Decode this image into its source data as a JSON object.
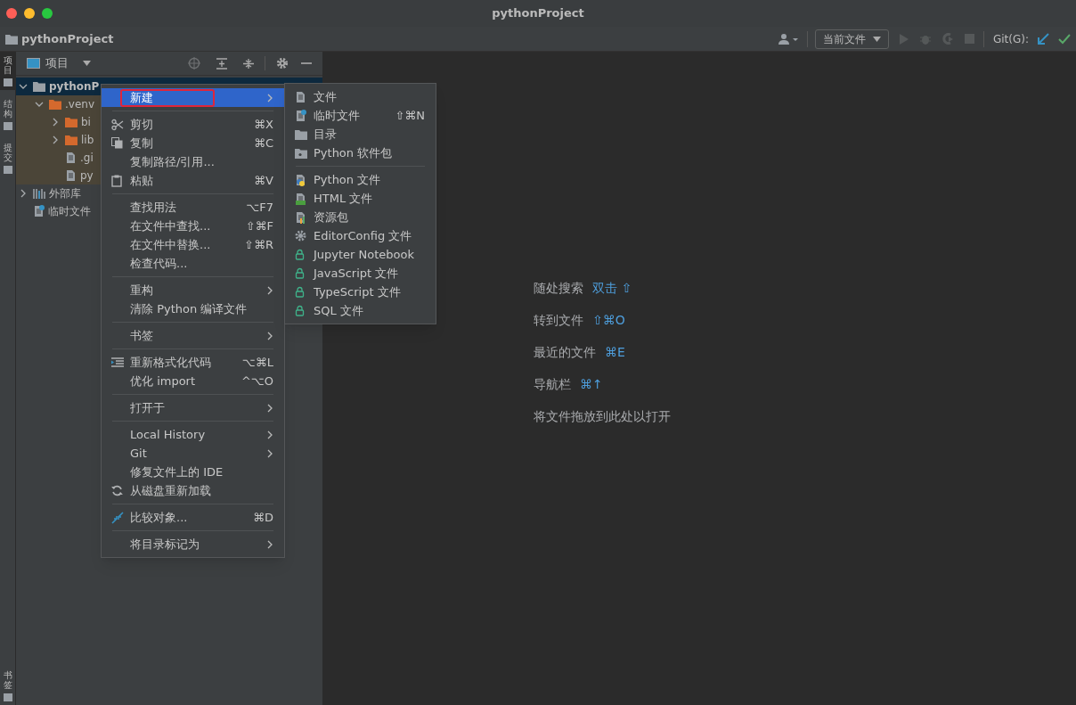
{
  "window": {
    "title": "pythonProject"
  },
  "nav_bar": {
    "project": "pythonProject",
    "run_config": "当前文件",
    "git_label": "Git(G):"
  },
  "left_stripe": [
    {
      "label": "项目",
      "selected": true
    },
    {
      "label": "结构",
      "selected": false
    },
    {
      "label": "提交",
      "selected": false
    }
  ],
  "left_stripe_bottom": [
    {
      "label": "书签",
      "selected": false
    }
  ],
  "project_panel": {
    "title": "项目",
    "tree": [
      {
        "label": "pythonP",
        "kind": "folder",
        "expanded": true,
        "selected": true,
        "children": [
          {
            "label": ".venv",
            "kind": "excluded",
            "expanded": true,
            "selected": false,
            "children": [
              {
                "label": "bi",
                "kind": "excluded",
                "expanded": false,
                "selected": false
              },
              {
                "label": "lib",
                "kind": "excluded",
                "expanded": false,
                "selected": false
              },
              {
                "label": ".gi",
                "kind": "ignored",
                "selected": false
              },
              {
                "label": "py",
                "kind": "file",
                "selected": false
              }
            ]
          }
        ]
      },
      {
        "label": "外部库",
        "kind": "library",
        "expanded": false,
        "selected": false
      },
      {
        "label": "临时文件",
        "kind": "scratch",
        "selected": false
      }
    ]
  },
  "context_menu": [
    {
      "kind": "item",
      "label": "新建",
      "submenu": true,
      "selected": true,
      "annotated": true
    },
    {
      "kind": "separator"
    },
    {
      "kind": "item",
      "label": "剪切",
      "shortcut": "⌘X",
      "selected": false
    },
    {
      "kind": "item",
      "label": "复制",
      "shortcut": "⌘C",
      "selected": false
    },
    {
      "kind": "item",
      "label": "复制路径/引用...",
      "selected": false
    },
    {
      "kind": "item",
      "label": "粘贴",
      "shortcut": "⌘V",
      "selected": false
    },
    {
      "kind": "separator"
    },
    {
      "kind": "item",
      "label": "查找用法",
      "shortcut": "⌥F7",
      "selected": false
    },
    {
      "kind": "item",
      "label": "在文件中查找...",
      "shortcut": "⇧⌘F",
      "selected": false
    },
    {
      "kind": "item",
      "label": "在文件中替换...",
      "shortcut": "⇧⌘R",
      "selected": false
    },
    {
      "kind": "item",
      "label": "检查代码...",
      "selected": false
    },
    {
      "kind": "separator"
    },
    {
      "kind": "item",
      "label": "重构",
      "submenu": true,
      "selected": false
    },
    {
      "kind": "item",
      "label": "清除 Python 编译文件",
      "selected": false
    },
    {
      "kind": "separator"
    },
    {
      "kind": "item",
      "label": "书签",
      "submenu": true,
      "selected": false
    },
    {
      "kind": "separator"
    },
    {
      "kind": "item",
      "label": "重新格式化代码",
      "shortcut": "⌥⌘L",
      "selected": false
    },
    {
      "kind": "item",
      "label": "优化 import",
      "shortcut": "^⌥O",
      "selected": false
    },
    {
      "kind": "separator"
    },
    {
      "kind": "item",
      "label": "打开于",
      "submenu": true,
      "selected": false
    },
    {
      "kind": "separator"
    },
    {
      "kind": "item",
      "label": "Local History",
      "submenu": true,
      "selected": false
    },
    {
      "kind": "item",
      "label": "Git",
      "submenu": true,
      "selected": false
    },
    {
      "kind": "item",
      "label": "修复文件上的 IDE",
      "selected": false
    },
    {
      "kind": "item",
      "label": "从磁盘重新加载",
      "selected": false
    },
    {
      "kind": "separator"
    },
    {
      "kind": "item",
      "label": "比较对象...",
      "shortcut": "⌘D",
      "selected": false
    },
    {
      "kind": "separator"
    },
    {
      "kind": "item",
      "label": "将目录标记为",
      "submenu": true,
      "selected": false
    }
  ],
  "new_submenu": [
    {
      "kind": "item",
      "label": "文件",
      "selected": false
    },
    {
      "kind": "item",
      "label": "临时文件",
      "shortcut": "⇧⌘N",
      "selected": false
    },
    {
      "kind": "item",
      "label": "目录",
      "selected": false
    },
    {
      "kind": "item",
      "label": "Python 软件包",
      "selected": false
    },
    {
      "kind": "separator"
    },
    {
      "kind": "item",
      "label": "Python 文件",
      "selected": false
    },
    {
      "kind": "item",
      "label": "HTML 文件",
      "selected": false
    },
    {
      "kind": "item",
      "label": "资源包",
      "selected": false
    },
    {
      "kind": "item",
      "label": "EditorConfig 文件",
      "selected": false
    },
    {
      "kind": "item",
      "label": "Jupyter Notebook",
      "selected": false
    },
    {
      "kind": "item",
      "label": "JavaScript 文件",
      "selected": false
    },
    {
      "kind": "item",
      "label": "TypeScript 文件",
      "selected": false
    },
    {
      "kind": "item",
      "label": "SQL 文件",
      "selected": false
    }
  ],
  "editor_hints": [
    {
      "label": "随处搜索",
      "shortcut": "双击 ⇧"
    },
    {
      "label": "转到文件",
      "shortcut": "⇧⌘O"
    },
    {
      "label": "最近的文件",
      "shortcut": "⌘E"
    },
    {
      "label": "导航栏",
      "shortcut": "⌘↑"
    },
    {
      "label": "将文件拖放到此处以打开"
    }
  ]
}
